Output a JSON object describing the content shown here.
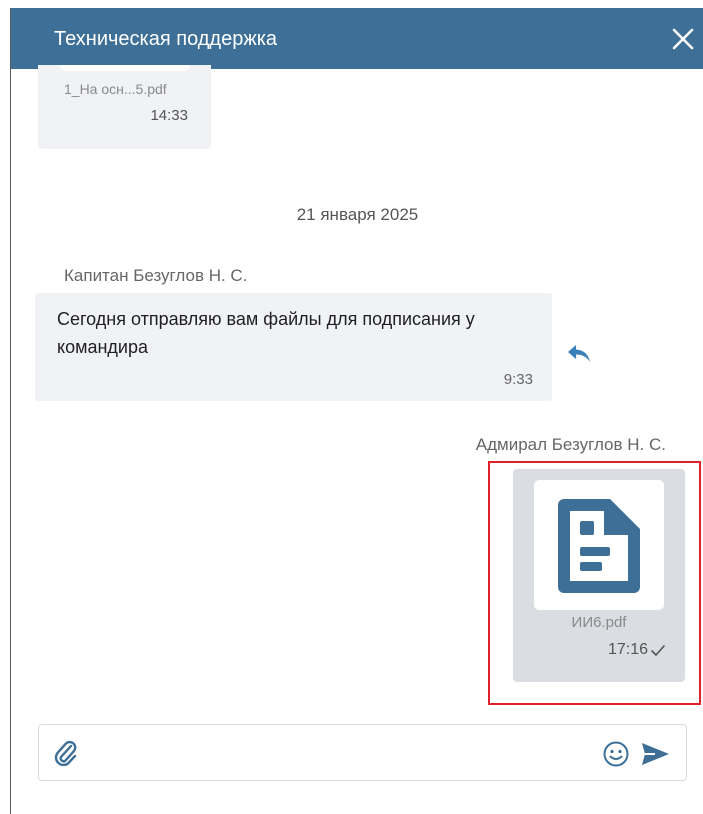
{
  "header": {
    "title": "Техническая поддержка",
    "close_icon": "close-icon"
  },
  "messages": {
    "previous": {
      "file_name": "1_На осн...5.pdf",
      "time": "14:33"
    },
    "date_separator": "21 января 2025",
    "incoming": {
      "sender": "Капитан Безуглов Н. С.",
      "text": "Сегодня отправляю вам файлы для подписания у командира",
      "time": "9:33",
      "action_icon": "reply-icon"
    },
    "outgoing": {
      "sender": "Адмирал Безуглов Н. С.",
      "file_name": "ИИ6.pdf",
      "time": "17:16",
      "file_icon": "document-icon",
      "status_icon": "checkmark-icon"
    }
  },
  "composer": {
    "value": "",
    "attach_icon": "paperclip-icon",
    "emoji_icon": "smiley-icon",
    "send_icon": "send-icon"
  },
  "colors": {
    "header": "#3e6f96",
    "accent_blue": "#3b7fb8",
    "bubble_incoming": "#f0f2f5",
    "bubble_outgoing": "#dadde2",
    "highlight": "#e0202a",
    "file_icon": "#3e6f96"
  }
}
